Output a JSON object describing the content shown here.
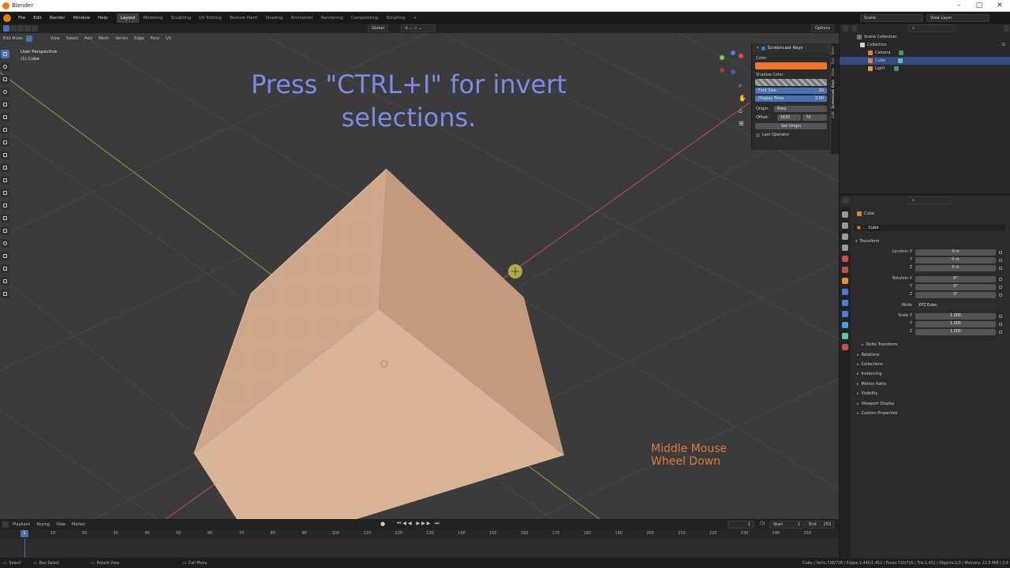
{
  "window": {
    "title": "Blender"
  },
  "menu": [
    "File",
    "Edit",
    "Render",
    "Window",
    "Help"
  ],
  "workspaces": [
    {
      "label": "Layout",
      "active": true
    },
    {
      "label": "Modeling"
    },
    {
      "label": "Sculpting"
    },
    {
      "label": "UV Editing"
    },
    {
      "label": "Texture Paint"
    },
    {
      "label": "Shading"
    },
    {
      "label": "Animation"
    },
    {
      "label": "Rendering"
    },
    {
      "label": "Compositing"
    },
    {
      "label": "Scripting"
    }
  ],
  "scene": {
    "scene_label": "Scene",
    "view_layer_label": "View Layer"
  },
  "viewport_header": {
    "mode": "Edit Mode",
    "menus": [
      "View",
      "Select",
      "Add",
      "Mesh",
      "Vertex",
      "Edge",
      "Face",
      "UV"
    ],
    "transform": "Global",
    "options": "Options"
  },
  "viewport": {
    "perspective": "User Perspective",
    "object": "(1) Cube",
    "caption_line1": "Press \"CTRL+I\" for invert",
    "caption_line2": "selections.",
    "mouse_line1": "Middle Mouse",
    "mouse_line2": "Wheel Down",
    "colors": {
      "cube": "#d9b090",
      "caption": "#7c8ce8",
      "mouse": "#e07a3d",
      "x_axis": "#c64b55",
      "y_axis": "#8aa03a"
    }
  },
  "npanel": {
    "title": "Screencast Keys",
    "color_label": "Color:",
    "shadow_label": "Shadow Color:",
    "font_size_label": "Font Size",
    "font_size": "29",
    "display_time_label": "Display Time",
    "display_time": "3.00",
    "origin_label": "Origin:",
    "origin_value": "Area",
    "offset_label": "Offset:",
    "offset_x": "1635",
    "offset_y": "70",
    "set_origin": "Set Origin",
    "last_operator": "Last Operator",
    "tabs": [
      "Item",
      "Tool",
      "View",
      "Screencast Keys",
      "Edit"
    ],
    "swatch_color": "#f0732a"
  },
  "outliner": {
    "rows": [
      {
        "label": "Scene Collection",
        "indent": 0
      },
      {
        "label": "Collection",
        "indent": 1
      },
      {
        "label": "Camera",
        "indent": 2
      },
      {
        "label": "Cube",
        "indent": 2,
        "selected": true
      },
      {
        "label": "Light",
        "indent": 2
      }
    ]
  },
  "properties": {
    "object_name": "Cube",
    "object_name2": "Cube",
    "transform_label": "Transform",
    "location_x_label": "Location X",
    "location_x": "0 m",
    "location_y_label": "Y",
    "location_y": "0 m",
    "location_z_label": "Z",
    "location_z": "0 m",
    "rotation_x_label": "Rotation X",
    "rotation_x": "0°",
    "rotation_y_label": "Y",
    "rotation_y": "0°",
    "rotation_z_label": "Z",
    "rotation_z": "0°",
    "mode_label": "Mode",
    "mode_value": "XYZ Euler",
    "scale_x_label": "Scale X",
    "scale_x": "1.000",
    "scale_y_label": "Y",
    "scale_y": "1.000",
    "scale_z_label": "Z",
    "scale_z": "1.000",
    "delta_transform": "Delta Transform",
    "sections": [
      "Relations",
      "Collections",
      "Instancing",
      "Motion Paths",
      "Visibility",
      "Viewport Display",
      "Custom Properties"
    ]
  },
  "timeline": {
    "menus": [
      "Playback",
      "Keying",
      "View",
      "Marker"
    ],
    "current_frame": "1",
    "start_label": "Start",
    "start": "1",
    "end_label": "End",
    "end": "250",
    "ticks": [
      "10",
      "20",
      "30",
      "40",
      "50",
      "60",
      "70",
      "80",
      "90",
      "100",
      "110",
      "120",
      "130",
      "140",
      "150",
      "160",
      "170",
      "180",
      "190",
      "200",
      "210",
      "220",
      "230",
      "240",
      "250"
    ]
  },
  "statusbar": {
    "select": "Select",
    "box_select": "Box Select",
    "rotate_view": "Rotate View",
    "call_menu": "Call Menu",
    "stats": "Cube | Verts:726/728 | Edges:1,445/1,452 | Faces:720/726 | Tris:1,452 | Objects:1/3 | Memory: 21.6 MiB | 2.9"
  }
}
